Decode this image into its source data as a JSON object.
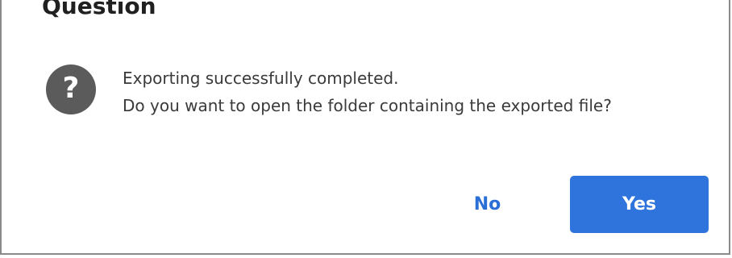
{
  "dialog": {
    "title": "Question",
    "icon": "question-mark-icon",
    "icon_glyph": "?",
    "message_lines": [
      "Exporting successfully completed.",
      "Do you want to open the folder containing the exported file?"
    ],
    "buttons": {
      "no_label": "No",
      "yes_label": "Yes"
    },
    "colors": {
      "accent": "#2f74dc",
      "icon_bg": "#5b5b5b"
    }
  }
}
